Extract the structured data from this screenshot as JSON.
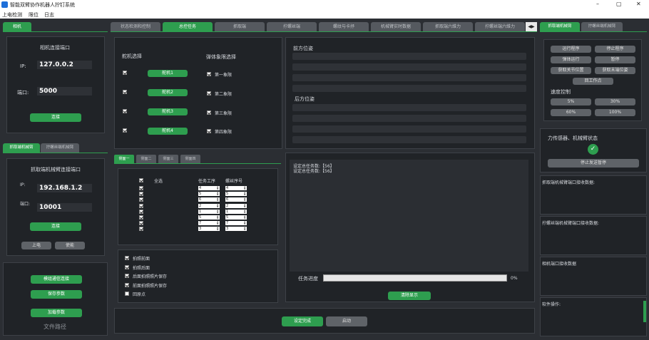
{
  "window": {
    "title": "智能双臂协作机器人拧钉系统",
    "min": "–",
    "restore": "▢",
    "close": "✕"
  },
  "menu": [
    "上电检测",
    "限位",
    "日志"
  ],
  "left": {
    "tab_camera": "相机",
    "camera_port_title": "相机连接端口",
    "ip_label": "IP:",
    "ip_value": "127.0.0.2",
    "port_label": "端口:",
    "port_value": "5000",
    "connect": "连接",
    "arm_tabs": [
      "抓取端机械臂",
      "拧螺丝端机械臂"
    ],
    "arm_port_title": "抓取端机械臂连接端口",
    "arm_ip_label": "IP:",
    "arm_ip_value": "192.168.1.2",
    "arm_port_label": "端口:",
    "arm_port_value": "10001",
    "arm_connect": "连接",
    "power_on": "上电",
    "enable": "使能",
    "module_connect": "模组通信连接",
    "save_params": "保存参数",
    "load_params": "加载参数",
    "file_path": "文件路径"
  },
  "tabs": [
    "状态检测和控制",
    "总控任务",
    "抓取端",
    "拧螺丝端",
    "螺纹与卡抒",
    "机械臂实时数据",
    "抓取端六维力",
    "拧螺丝端六维力"
  ],
  "active_tab": "总控任务",
  "center": {
    "rudder_title": "舵机选择",
    "rudders": [
      "舵机1",
      "舵机2",
      "舵机3",
      "舵机4"
    ],
    "quadrant_title": "弹体象限选择",
    "quadrants": [
      "第一象限",
      "第二象限",
      "第三象限",
      "第四象限"
    ],
    "front_pose": "前方位姿",
    "rear_pose": "后方位姿",
    "face_tabs": [
      "侧面一",
      "侧面二",
      "侧面三",
      "侧面四"
    ],
    "select_all": "全选",
    "col_task": "任务工序",
    "col_screw": "螺丝序号",
    "task_rows": [
      [
        "4",
        "4"
      ],
      [
        "5",
        "5"
      ],
      [
        "6",
        "6"
      ],
      [
        "2",
        "2"
      ],
      [
        "1",
        "1"
      ],
      [
        "5",
        "5"
      ],
      [
        "7",
        "7"
      ],
      [
        "3",
        "3"
      ]
    ],
    "options": [
      {
        "label": "拍照前面",
        "checked": true
      },
      {
        "label": "拍照后面",
        "checked": true
      },
      {
        "label": "后面拍照照片保存",
        "checked": true
      },
      {
        "label": "前面拍照照片保存",
        "checked": true
      },
      {
        "label": "回原点",
        "checked": false
      }
    ],
    "log_lines": [
      "设定总任务数:【56】",
      "设定总任务数:【56】"
    ],
    "progress_label": "任务进度",
    "progress_value": "0%",
    "progress_fraction": 0,
    "clear_display": "清除显示",
    "confirm_setting": "设定完成",
    "start": "启动"
  },
  "right": {
    "tabs": [
      "抓取端机械臂",
      "拧螺丝端机械臂"
    ],
    "buttons": [
      [
        "运行程序",
        "停止程序"
      ],
      [
        "弹体运行",
        "暂停"
      ],
      [
        "获取关节位置",
        "获取末端位姿"
      ]
    ],
    "return_origin": "回工作点",
    "speed_title": "速度控制",
    "speeds": [
      [
        "5%",
        "30%"
      ],
      [
        "60%",
        "100%"
      ]
    ],
    "force_title": "力传感器、机械臂状态",
    "stop_pause": "停止发送暂停",
    "grab_port_data": "抓取端机械臂端口接收数据:",
    "screw_port_data": "拧螺丝端机械臂端口接收数据:",
    "camera_port_data": "相机端口接收数据",
    "software_ops": "软件操作:"
  }
}
